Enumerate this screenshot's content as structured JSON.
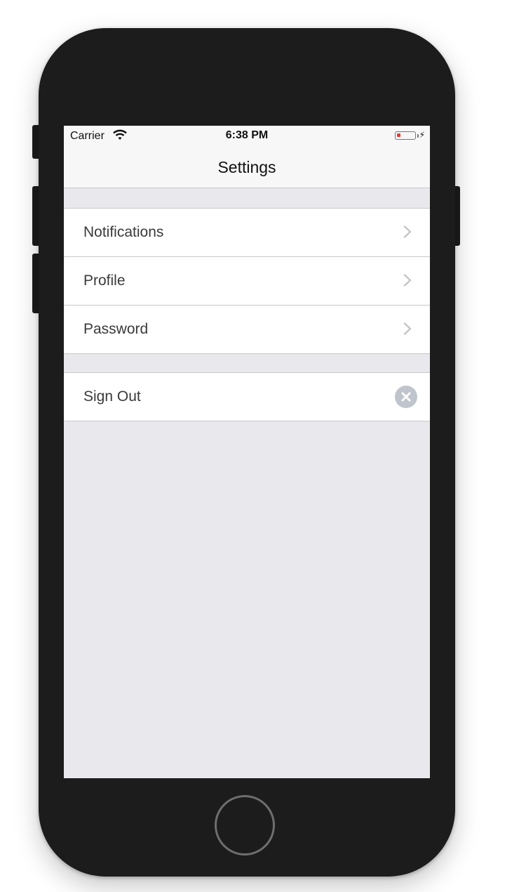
{
  "status_bar": {
    "carrier": "Carrier",
    "time": "6:38 PM"
  },
  "nav": {
    "title": "Settings"
  },
  "sections": [
    {
      "items": [
        {
          "label": "Notifications",
          "accessory": "chevron-right-icon"
        },
        {
          "label": "Profile",
          "accessory": "chevron-right-icon"
        },
        {
          "label": "Password",
          "accessory": "chevron-right-icon"
        }
      ]
    },
    {
      "items": [
        {
          "label": "Sign Out",
          "accessory": "clear-circle-icon"
        }
      ]
    }
  ],
  "colors": {
    "background": "#e8e8ed",
    "bar": "#f7f7f7",
    "separator": "#c8c7cc",
    "battery_low": "#e53935",
    "device": "#1c1c1c"
  }
}
